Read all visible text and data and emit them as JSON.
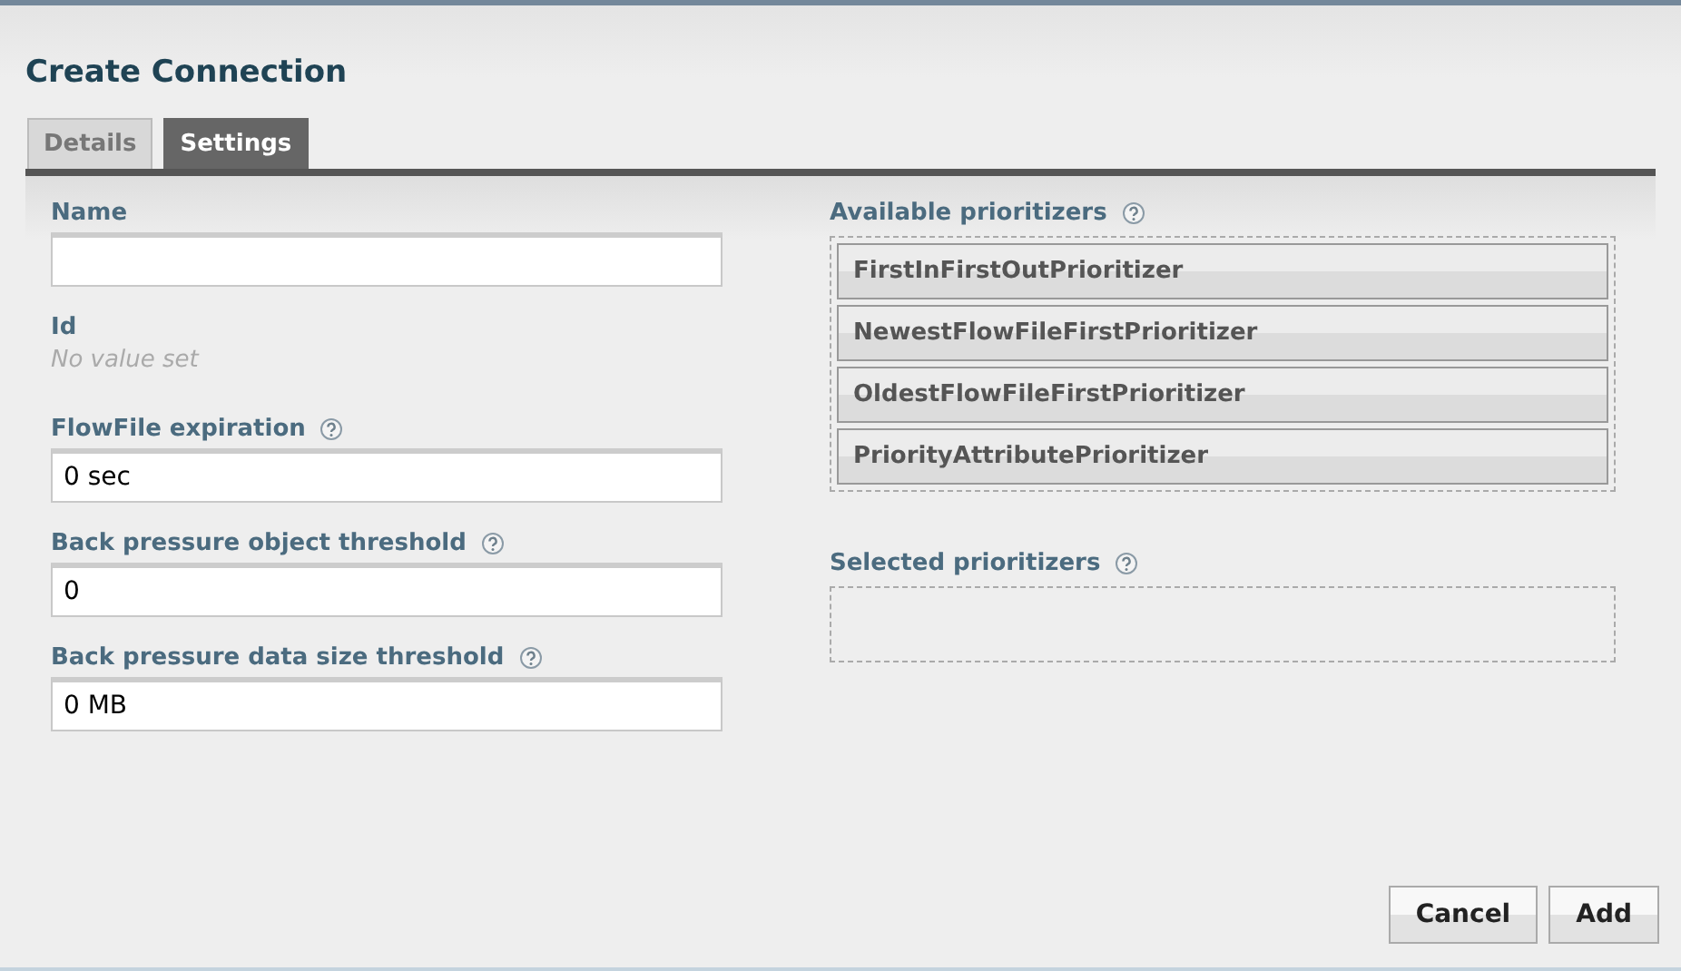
{
  "dialog": {
    "title": "Create Connection"
  },
  "tabs": [
    {
      "label": "Details",
      "selected": false
    },
    {
      "label": "Settings",
      "selected": true
    }
  ],
  "fields": [
    {
      "kind": "input",
      "label": "Name",
      "help": false
    },
    {
      "kind": "readonly",
      "label": "Id",
      "help": false,
      "value": "No value set"
    },
    {
      "kind": "input",
      "label": "FlowFile expiration",
      "help": true,
      "value": "0 sec"
    },
    {
      "kind": "input",
      "label": "Back pressure object threshold",
      "help": true,
      "value": "0"
    },
    {
      "kind": "input",
      "label": "Back pressure data size threshold",
      "help": true,
      "value": "0 MB"
    }
  ],
  "available_prioritizers": {
    "label": "Available prioritizers",
    "help": true,
    "items": [
      "FirstInFirstOutPrioritizer",
      "NewestFlowFileFirstPrioritizer",
      "OldestFlowFileFirstPrioritizer",
      "PriorityAttributePrioritizer"
    ]
  },
  "selected_prioritizers": {
    "label": "Selected prioritizers",
    "help": true
  },
  "buttons": [
    "Cancel",
    "Add"
  ]
}
